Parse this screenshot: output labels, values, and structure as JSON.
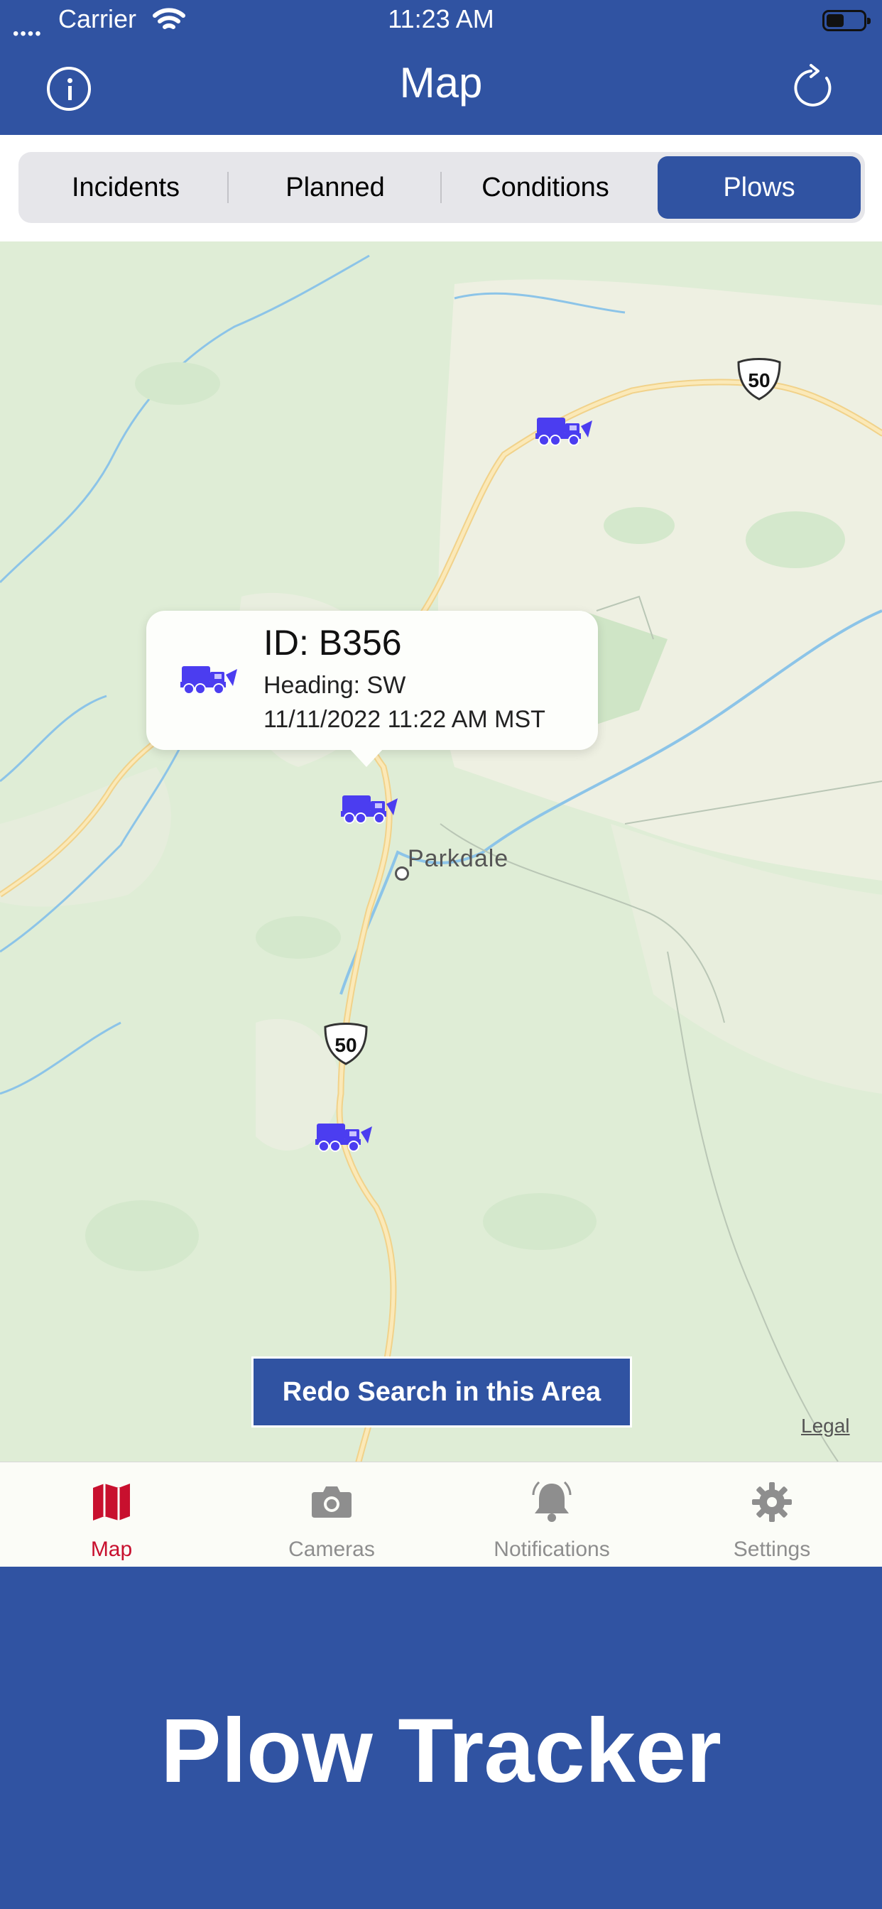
{
  "status_bar": {
    "carrier": "Carrier",
    "time": "11:23 AM"
  },
  "header": {
    "title": "Map",
    "info_icon": "info-circle-icon",
    "refresh_icon": "refresh-icon"
  },
  "segments": {
    "items": [
      "Incidents",
      "Planned",
      "Conditions",
      "Plows"
    ],
    "selected": "Plows"
  },
  "map": {
    "callout": {
      "id": "ID: B356",
      "heading": "Heading: SW",
      "timestamp": "11/11/2022 11:22 AM MST"
    },
    "town": "Parkdale",
    "highway_shield_1": "50",
    "highway_shield_2": "50",
    "redo_button": "Redo Search in this Area",
    "legal": "Legal"
  },
  "tabbar": {
    "items": [
      {
        "label": "Map",
        "icon": "map-icon",
        "active": true
      },
      {
        "label": "Cameras",
        "icon": "camera-icon",
        "active": false
      },
      {
        "label": "Notifications",
        "icon": "bell-icon",
        "active": false
      },
      {
        "label": "Settings",
        "icon": "gear-icon",
        "active": false
      }
    ]
  },
  "banner": {
    "title": "Plow Tracker"
  },
  "colors": {
    "brand_blue": "#3053a2",
    "active_tab": "#c8102e",
    "plow_icon": "#4b3df0"
  }
}
